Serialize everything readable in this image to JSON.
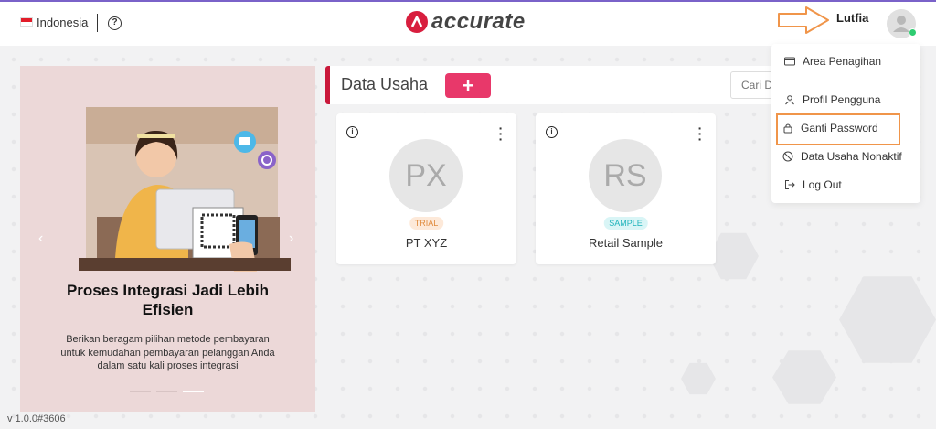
{
  "header": {
    "language": "Indonesia",
    "help_symbol": "?",
    "logo_text": "accurate",
    "username": "Lutfia",
    "accent_color": "#7a62c9"
  },
  "banner": {
    "title": "Proses Integrasi Jadi Lebih Efisien",
    "description": "Berikan beragam pilihan metode pembayaran untuk kemudahan pembayaran pelanggan Anda dalam satu kali proses integrasi",
    "prev_symbol": "‹",
    "next_symbol": "›",
    "slides": 3,
    "active_slide": 3
  },
  "data_usaha": {
    "title": "Data Usaha",
    "add_symbol": "+",
    "search_placeholder": "Cari D"
  },
  "cards": [
    {
      "initials": "PX",
      "badge": "TRIAL",
      "name": "PT XYZ"
    },
    {
      "initials": "RS",
      "badge": "SAMPLE",
      "name": "Retail Sample"
    }
  ],
  "user_menu": {
    "items": [
      {
        "label": "Area Penagihan",
        "icon": "billing-card-icon"
      },
      {
        "label": "Profil Pengguna",
        "icon": "user-icon"
      },
      {
        "label": "Ganti Password",
        "icon": "lock-icon",
        "highlighted": true
      },
      {
        "label": "Data Usaha Nonaktif",
        "icon": "block-icon"
      },
      {
        "label": "Log Out",
        "icon": "logout-icon"
      }
    ]
  },
  "version": "v 1.0.0#3606"
}
